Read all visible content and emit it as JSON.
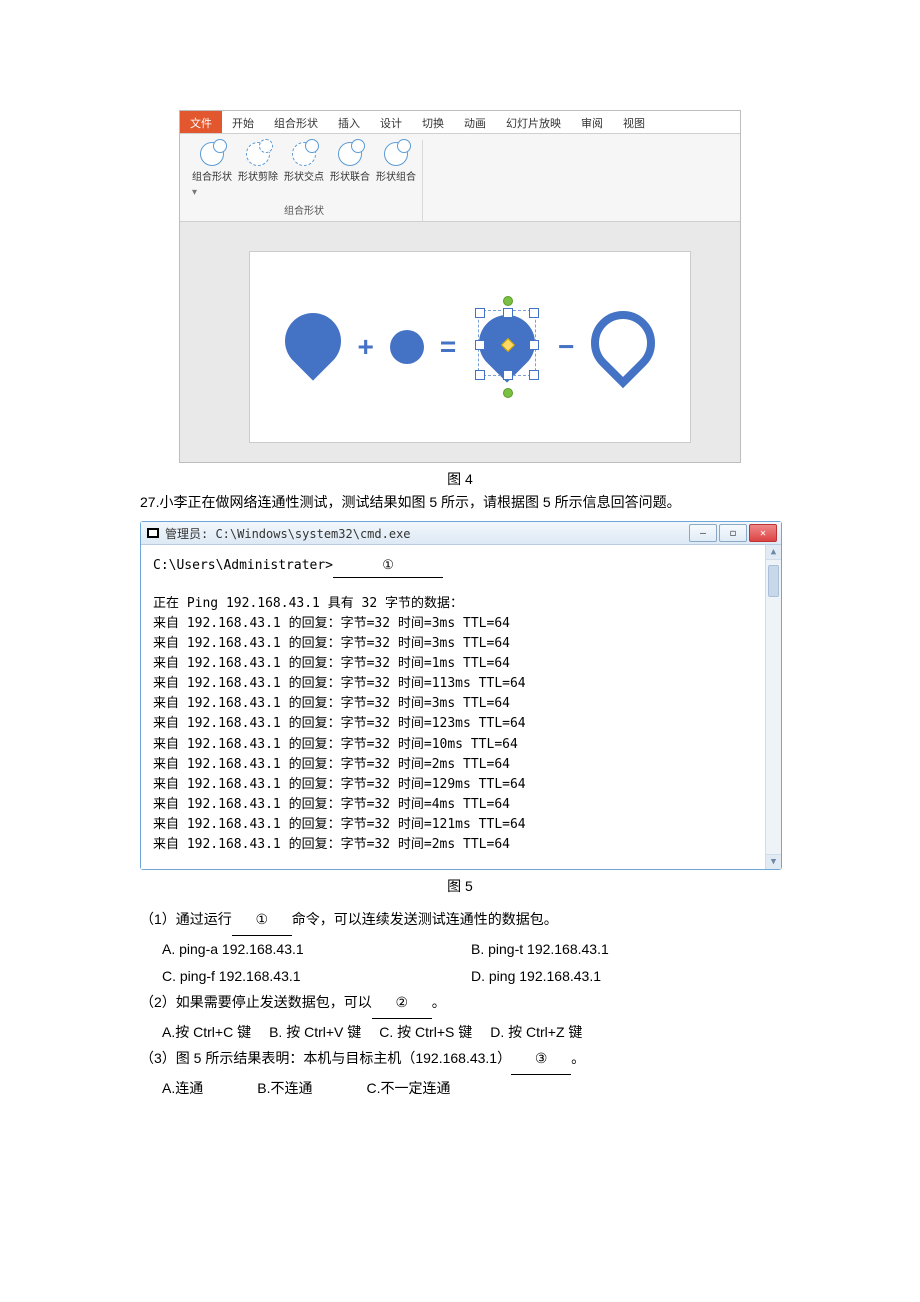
{
  "figure4": {
    "tabs": [
      "文件",
      "开始",
      "组合形状",
      "插入",
      "设计",
      "切换",
      "动画",
      "幻灯片放映",
      "审阅",
      "视图"
    ],
    "active_tab_index": 0,
    "ribbon_buttons": [
      "组合形状",
      "形状剪除",
      "形状交点",
      "形状联合",
      "形状组合"
    ],
    "ribbon_group_label": "组合形状",
    "ops": {
      "plus": "+",
      "equals": "=",
      "minus": "−"
    },
    "caption": "图 4"
  },
  "q27_intro": "27.小李正在做网络连通性测试，测试结果如图 5 所示，请根据图 5 所示信息回答问题。",
  "cmd": {
    "title_prefix": "管理员: ",
    "title_path": "C:\\Windows\\system32\\cmd.exe",
    "prompt": "C:\\Users\\Administrater>",
    "blank_marker": "①",
    "ping_header": "正在 Ping 192.168.43.1   具有 32 字节的数据：",
    "replies": [
      "来自  192.168.43.1  的回复：字节=32  时间=3ms TTL=64",
      "来自  192.168.43.1  的回复：字节=32  时间=3ms TTL=64",
      "来自  192.168.43.1  的回复：字节=32  时间=1ms TTL=64",
      "来自  192.168.43.1  的回复：字节=32  时间=113ms TTL=64",
      "来自  192.168.43.1  的回复：字节=32  时间=3ms TTL=64",
      "来自  192.168.43.1  的回复：字节=32  时间=123ms TTL=64",
      "来自  192.168.43.1  的回复：字节=32  时间=10ms TTL=64",
      "来自  192.168.43.1  的回复：字节=32  时间=2ms TTL=64",
      "来自  192.168.43.1  的回复：字节=32  时间=129ms TTL=64",
      "来自  192.168.43.1  的回复：字节=32  时间=4ms TTL=64",
      "来自  192.168.43.1  的回复：字节=32  时间=121ms TTL=64",
      "来自  192.168.43.1  的回复：字节=32  时间=2ms TTL=64"
    ],
    "caption": "图 5"
  },
  "questions": {
    "q1": {
      "stem_before": "（1）通过运行",
      "blank": "①",
      "stem_after": "命令，可以连续发送测试连通性的数据包。",
      "opts": {
        "A": "A. ping-a 192.168.43.1",
        "B": "B. ping-t 192.168.43.1",
        "C": "C. ping-f 192.168.43.1",
        "D": "D. ping 192.168.43.1"
      }
    },
    "q2": {
      "stem_before": "（2）如果需要停止发送数据包，可以",
      "blank": "②",
      "stem_after": "。",
      "opts": {
        "A": "A.按 Ctrl+C 键",
        "B": "B.  按 Ctrl+V 键",
        "C": "C.  按 Ctrl+S 键",
        "D": "D.  按 Ctrl+Z 键"
      }
    },
    "q3": {
      "stem_before": "（3）图 5 所示结果表明：本机与目标主机（192.168.43.1）",
      "blank": "③",
      "stem_after": "。",
      "opts": {
        "A": "A.连通",
        "B": "B.不连通",
        "C": "C.不一定连通"
      }
    }
  }
}
